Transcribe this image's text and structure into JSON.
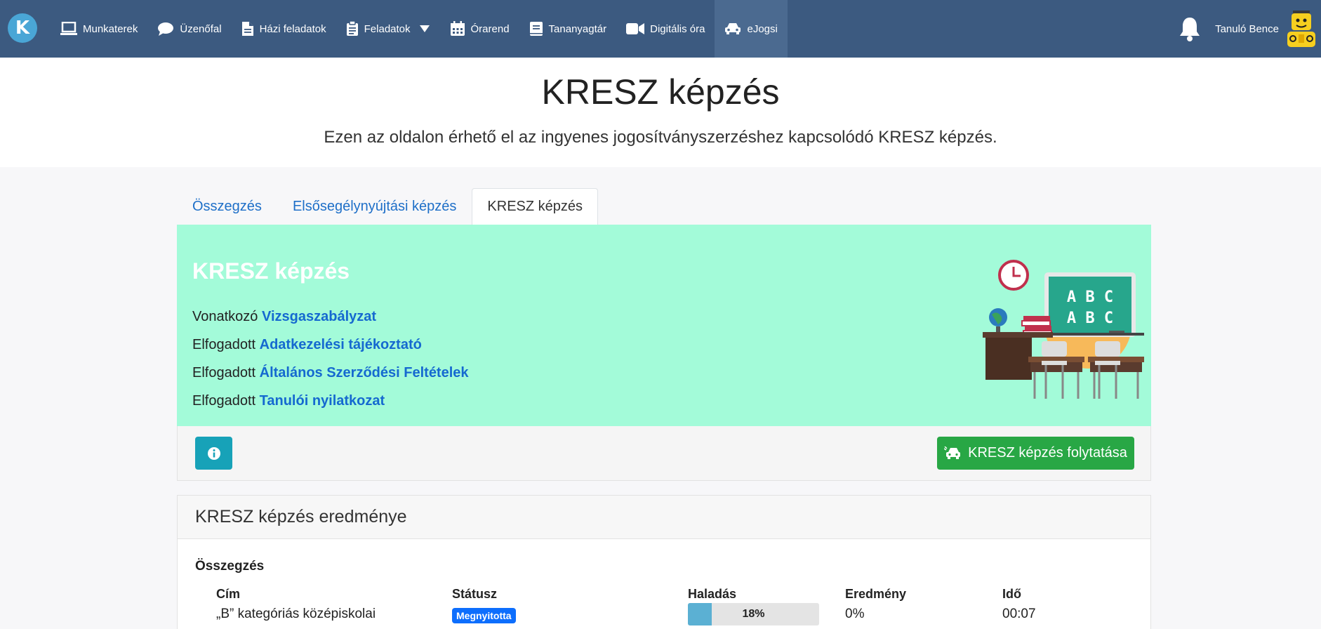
{
  "nav": {
    "logo_letter": "K",
    "items": [
      {
        "label": "Munkaterek",
        "icon": "laptop-icon"
      },
      {
        "label": "Üzenőfal",
        "icon": "speech-bubble-icon"
      },
      {
        "label": "Házi feladatok",
        "icon": "file-icon"
      },
      {
        "label": "Feladatok",
        "icon": "clipboard-icon"
      },
      {
        "label": "Órarend",
        "icon": "calendar-icon"
      },
      {
        "label": "Tananyagtár",
        "icon": "book-icon"
      },
      {
        "label": "Digitális óra",
        "icon": "video-camera-icon"
      },
      {
        "label": "eJogsi",
        "icon": "car-icon"
      }
    ],
    "user_name": "Tanuló Bence"
  },
  "header": {
    "title": "KRESZ képzés",
    "subtitle": "Ezen az oldalon érhető el az ingyenes jogosítványszerzéshez kapcsolódó KRESZ képzés."
  },
  "tabs": [
    {
      "label": "Összegzés"
    },
    {
      "label": "Elsősegélynyújtási képzés"
    },
    {
      "label": "KRESZ képzés"
    }
  ],
  "info_panel": {
    "title": "KRESZ képzés",
    "illustration_letters": "A B C",
    "lines": [
      {
        "prefix": "Vonatkozó",
        "link": "Vizsgaszabályzat"
      },
      {
        "prefix": "Elfogadott",
        "link": "Adatkezelési tájékoztató"
      },
      {
        "prefix": "Elfogadott",
        "link": "Általános Szerződési Feltételek"
      },
      {
        "prefix": "Elfogadott",
        "link": "Tanulói nyilatkozat"
      }
    ]
  },
  "actions": {
    "continue_label": "KRESZ képzés folytatása",
    "info_icon": "info-circle-icon"
  },
  "results": {
    "header": "KRESZ képzés eredménye",
    "section_title": "Összegzés",
    "columns": [
      "Cím",
      "Státusz",
      "Haladás",
      "Eredmény",
      "Idő"
    ],
    "row": {
      "title_line1": "„B” kategóriás középiskolai",
      "status": "Megnyitotta",
      "progress": 0.18,
      "progress_label": "18%",
      "result": "0%",
      "time": "00:07"
    }
  },
  "colors": {
    "nav_bg": "#3c5a80",
    "panel_bg": "#a3fbd9",
    "info_btn": "#17a2b8",
    "continue_btn": "#28a745",
    "badge": "#0d6efd",
    "link": "#1569d0"
  }
}
